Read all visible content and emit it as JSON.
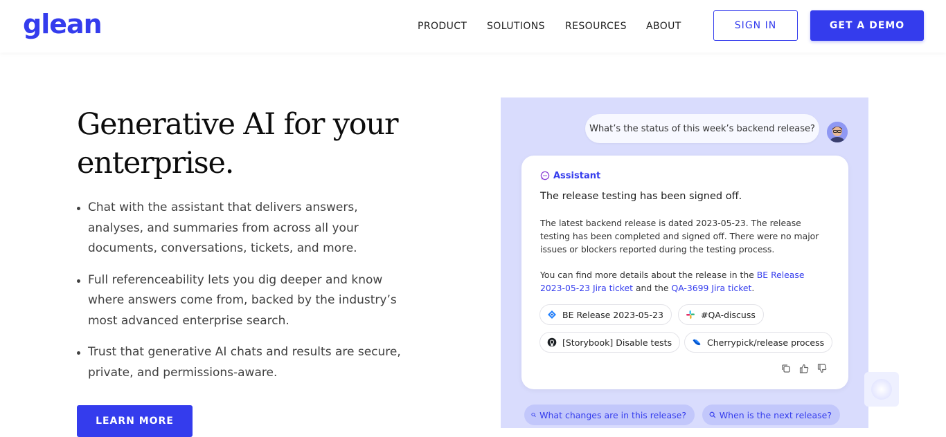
{
  "brand": {
    "logo_text": "glean",
    "accent": "#343ced"
  },
  "nav": {
    "items": [
      "PRODUCT",
      "SOLUTIONS",
      "RESOURCES",
      "ABOUT"
    ],
    "sign_in": "SIGN IN",
    "get_demo": "GET A DEMO"
  },
  "hero": {
    "title_line1": "Generative AI for your",
    "title_line2": "enterprise.",
    "bullets": [
      "Chat with the assistant that delivers answers, analyses, and summaries from across all your documents, conversations, tickets, and more.",
      "Full referenceability lets you dig deeper and know where answers come from, backed by the industry’s most advanced enterprise search.",
      "Trust that generative AI chats and results are secure, private, and permissions-aware."
    ],
    "cta": "LEARN MORE"
  },
  "demo": {
    "user_question": "What’s the status of this week’s backend release?",
    "assistant_label": "Assistant",
    "headline": "The release testing has been signed off.",
    "body1": "The latest backend release is dated 2023-05-23. The release testing has been completed and signed off. There were no major issues or blockers reported during the testing process.",
    "body2_prefix": "You can find more details about the release in the ",
    "body2_link1": "BE Release 2023-05-23 Jira ticket",
    "body2_mid": " and the ",
    "body2_link2": "QA-3699 Jira ticket",
    "body2_suffix": ".",
    "sources": [
      {
        "label": "BE Release 2023-05-23",
        "icon": "jira-icon"
      },
      {
        "label": "#QA-discuss",
        "icon": "slack-icon"
      },
      {
        "label": "[Storybook] Disable tests",
        "icon": "github-icon"
      },
      {
        "label": "Cherrypick/release process",
        "icon": "confluence-icon"
      }
    ],
    "suggestions": [
      "What changes are in this release?",
      "When is the next release?"
    ]
  }
}
